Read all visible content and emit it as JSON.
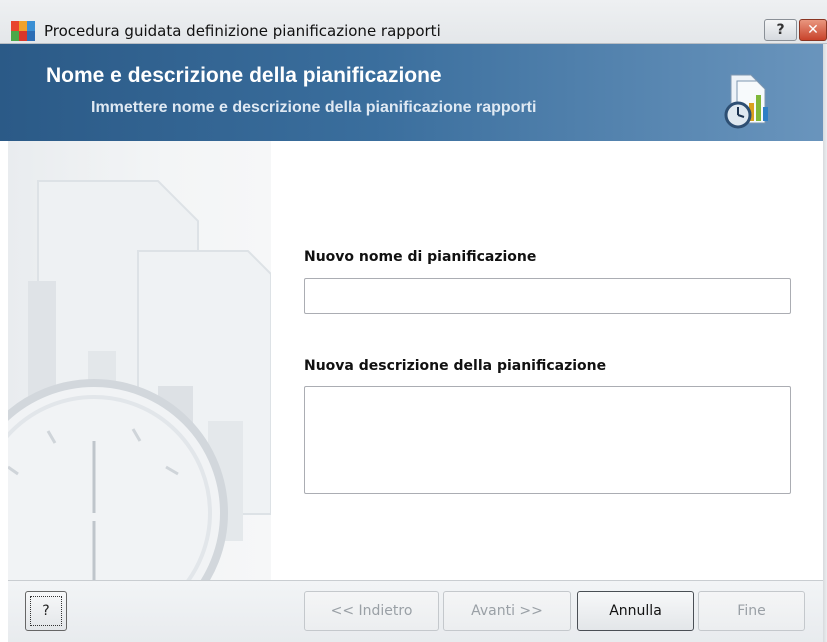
{
  "window": {
    "title": "Procedura guidata definizione pianificazione rapporti",
    "help_glyph": "?",
    "close_glyph": "✕"
  },
  "banner": {
    "title": "Nome e descrizione della pianificazione",
    "subtitle": "Immettere nome e descrizione della pianificazione rapporti",
    "icon": "report-schedule-icon"
  },
  "form": {
    "name_label": "Nuovo nome di pianificazione",
    "name_value": "",
    "description_label": "Nuova descrizione della pianificazione",
    "description_value": ""
  },
  "footer": {
    "help_label": "?",
    "back_label": "<< Indietro",
    "next_label": "Avanti >>",
    "cancel_label": "Annulla",
    "finish_label": "Fine"
  },
  "colors": {
    "banner_dark": "#2b5a87",
    "banner_light": "#6a95bd",
    "close_red": "#c8432b"
  }
}
